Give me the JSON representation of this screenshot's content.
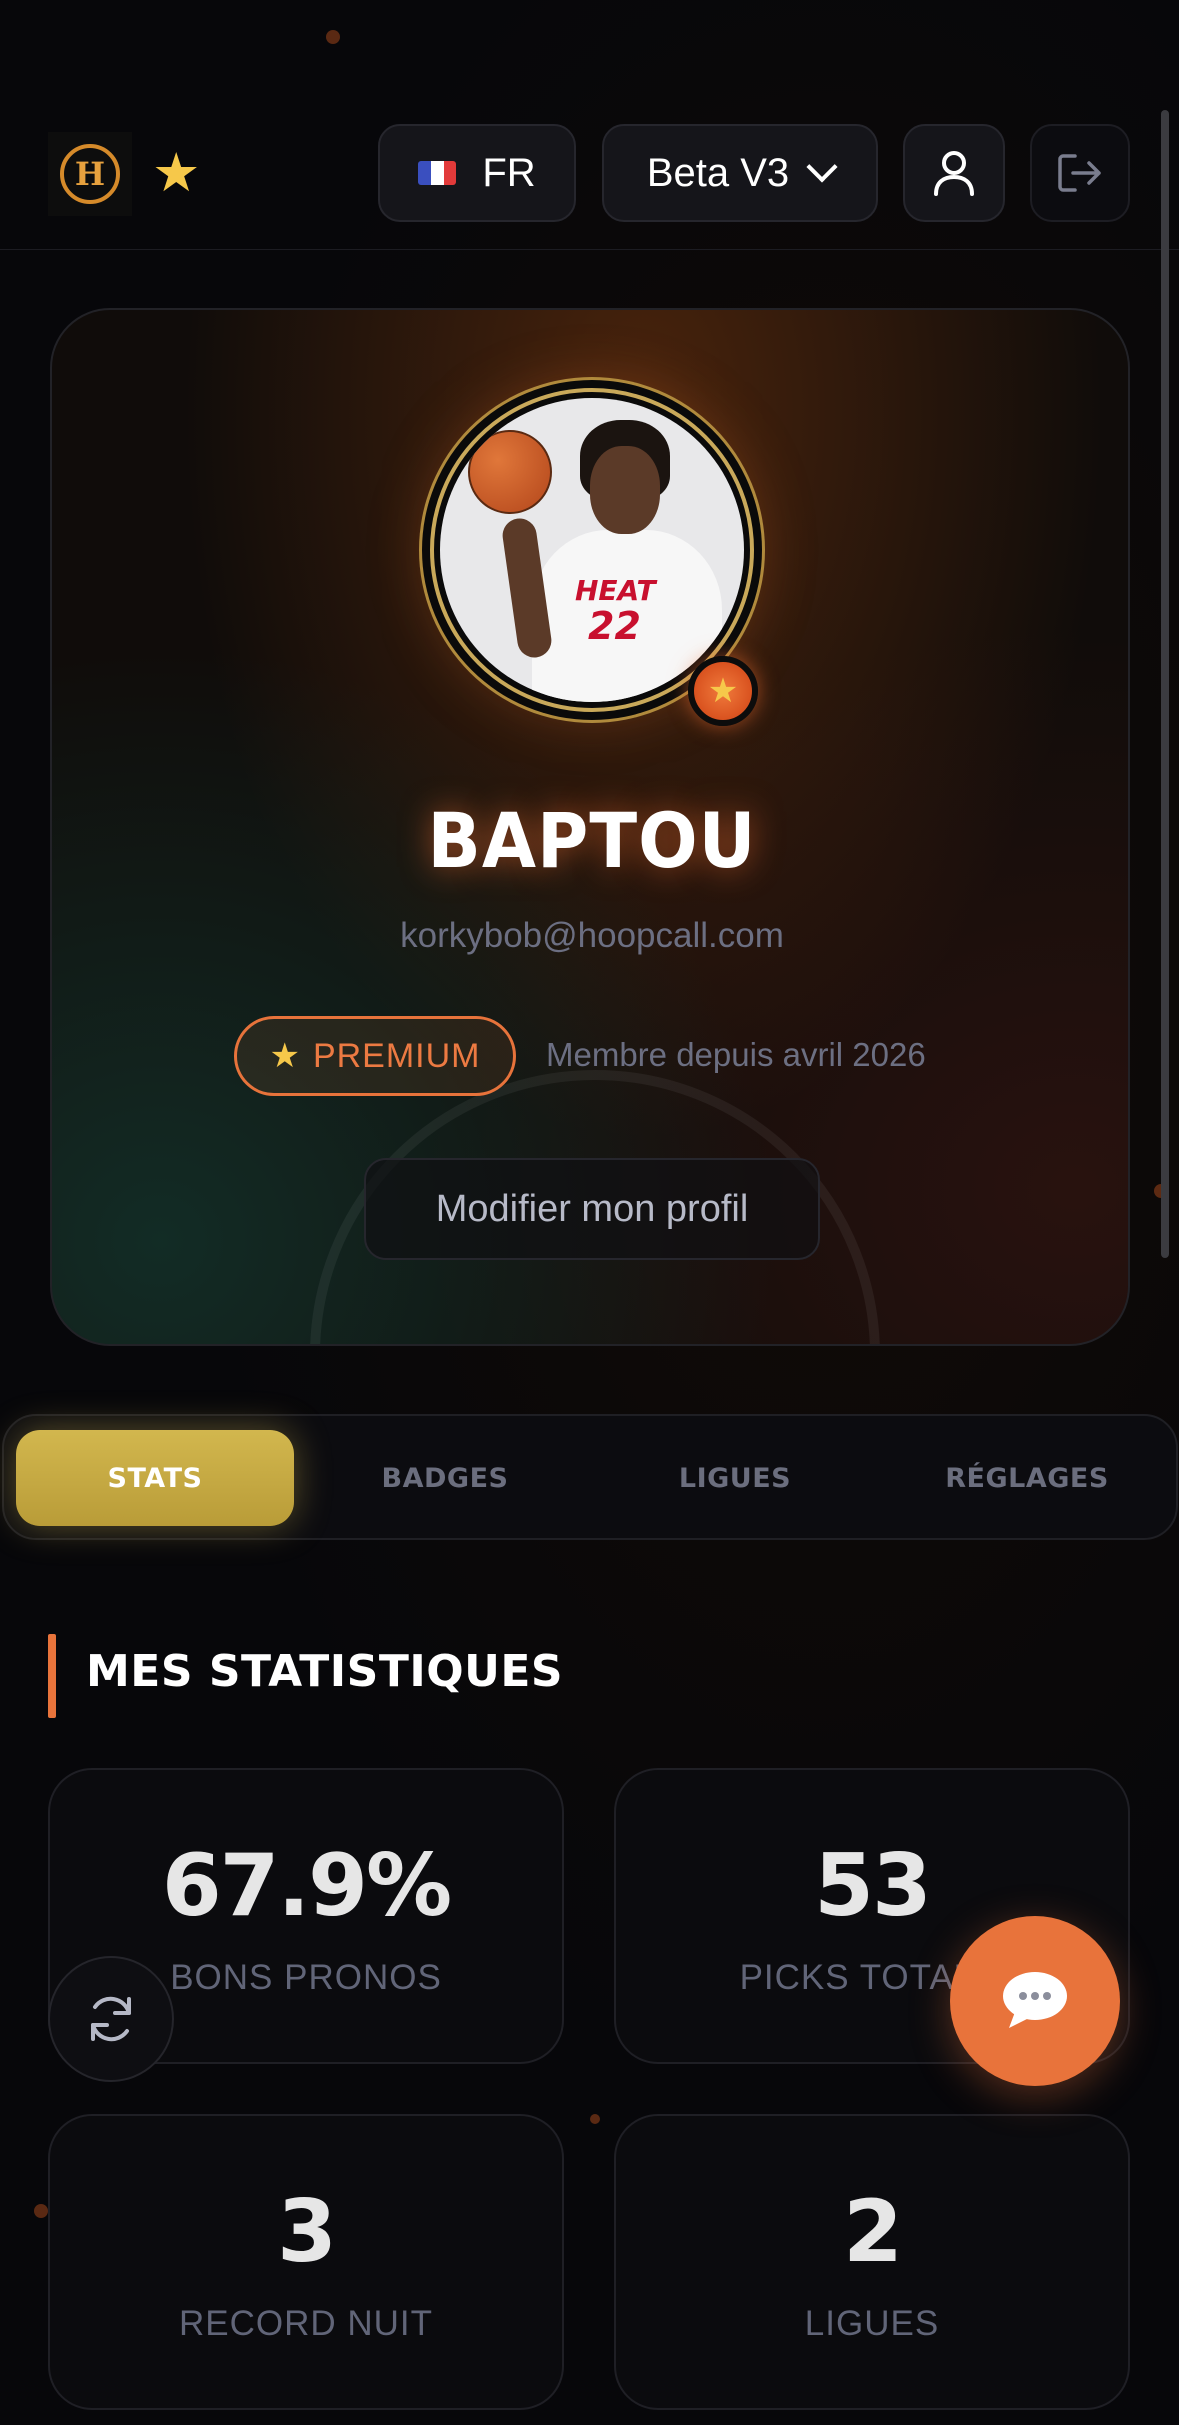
{
  "header": {
    "logo_letter": "H",
    "favorite_icon": "star-icon",
    "language": {
      "flag": [
        "#3a4fbf",
        "#ffffff",
        "#e23a3a"
      ],
      "label": "FR"
    },
    "version": {
      "label": "Beta V3"
    },
    "user_icon": "user-icon",
    "logout_icon": "logout-icon"
  },
  "profile": {
    "avatar_jersey_text": "HEAT",
    "avatar_jersey_number": "22",
    "avatar_badge_icon": "star-icon",
    "name": "BAPTOU",
    "email": "korkybob@hoopcall.com",
    "premium_label": "PREMIUM",
    "member_since": "Membre depuis avril 2026",
    "edit_button": "Modifier mon profil"
  },
  "tabs": [
    {
      "label": "STATS",
      "active": true
    },
    {
      "label": "BADGES",
      "active": false
    },
    {
      "label": "LIGUES",
      "active": false
    },
    {
      "label": "RÉGLAGES",
      "active": false
    }
  ],
  "stats_section": {
    "title": "MES STATISTIQUES",
    "cards": [
      {
        "value": "67.9%",
        "label": "BONS PRONOS"
      },
      {
        "value": "53",
        "label": "PICKS TOTAUX"
      },
      {
        "value": "3",
        "label": "RECORD NUIT"
      },
      {
        "value": "2",
        "label": "LIGUES"
      }
    ]
  },
  "floating": {
    "refresh_icon": "refresh-icon",
    "chat_icon": "chat-bubble-icon"
  },
  "colors": {
    "accent": "#e8733b",
    "tab_active": "#c9ad45",
    "background": "#07070a"
  }
}
